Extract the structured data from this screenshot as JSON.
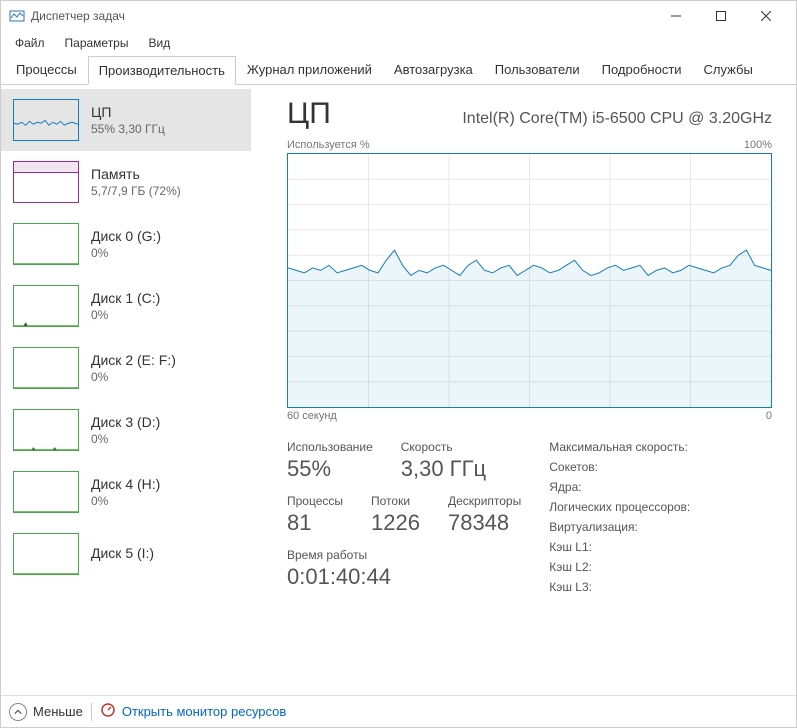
{
  "window": {
    "title": "Диспетчер задач"
  },
  "menu": {
    "file": "Файл",
    "options": "Параметры",
    "view": "Вид"
  },
  "tabs": [
    {
      "label": "Процессы"
    },
    {
      "label": "Производительность"
    },
    {
      "label": "Журнал приложений"
    },
    {
      "label": "Автозагрузка"
    },
    {
      "label": "Пользователи"
    },
    {
      "label": "Подробности"
    },
    {
      "label": "Службы"
    }
  ],
  "sidebar": {
    "items": [
      {
        "title": "ЦП",
        "sub": "55% 3,30 ГГц",
        "kind": "cpu",
        "selected": true
      },
      {
        "title": "Память",
        "sub": "5,7/7,9 ГБ (72%)",
        "kind": "mem"
      },
      {
        "title": "Диск 0 (G:)",
        "sub": "0%",
        "kind": "disk"
      },
      {
        "title": "Диск 1 (C:)",
        "sub": "0%",
        "kind": "disk"
      },
      {
        "title": "Диск 2 (E: F:)",
        "sub": "0%",
        "kind": "disk"
      },
      {
        "title": "Диск 3 (D:)",
        "sub": "0%",
        "kind": "disk"
      },
      {
        "title": "Диск 4 (H:)",
        "sub": "0%",
        "kind": "disk"
      },
      {
        "title": "Диск 5 (I:)",
        "sub": "",
        "kind": "disk"
      }
    ]
  },
  "cpu": {
    "heading": "ЦП",
    "model": "Intel(R) Core(TM) i5-6500 CPU @ 3.20GHz",
    "chart": {
      "top_left": "Используется %",
      "top_right": "100%",
      "bottom_left": "60 секунд",
      "bottom_right": "0"
    },
    "stats": {
      "utilization_label": "Использование",
      "utilization_value": "55%",
      "speed_label": "Скорость",
      "speed_value": "3,30 ГГц",
      "processes_label": "Процессы",
      "processes_value": "81",
      "threads_label": "Потоки",
      "threads_value": "1226",
      "handles_label": "Дескрипторы",
      "handles_value": "78348",
      "uptime_label": "Время работы",
      "uptime_value": "0:01:40:44"
    },
    "specs": {
      "max_speed": "Максимальная скорость:",
      "sockets": "Сокетов:",
      "cores": "Ядра:",
      "logical": "Логических процессоров:",
      "virtualization": "Виртуализация:",
      "l1": "Кэш L1:",
      "l2": "Кэш L2:",
      "l3": "Кэш L3:"
    }
  },
  "bottom": {
    "less": "Меньше",
    "monitor": "Открыть монитор ресурсов"
  },
  "chart_data": {
    "type": "line",
    "title": "Используется %",
    "xlabel": "секунд",
    "ylabel": "%",
    "ylim": [
      0,
      100
    ],
    "xlim_seconds": [
      60,
      0
    ],
    "values": [
      55,
      54,
      53,
      55,
      54,
      56,
      53,
      54,
      55,
      56,
      54,
      53,
      58,
      62,
      56,
      52,
      54,
      53,
      55,
      56,
      54,
      52,
      56,
      58,
      54,
      53,
      55,
      56,
      52,
      54,
      56,
      55,
      53,
      54,
      56,
      58,
      54,
      52,
      53,
      55,
      56,
      54,
      55,
      56,
      52,
      54,
      55,
      53,
      54,
      56,
      55,
      54,
      53,
      55,
      56,
      60,
      62,
      56,
      55,
      54
    ]
  }
}
